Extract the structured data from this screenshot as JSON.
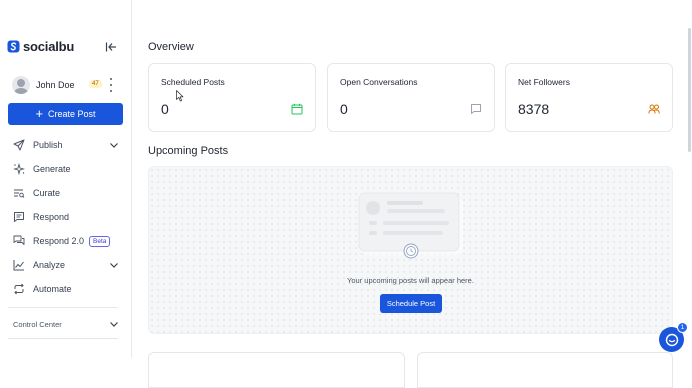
{
  "brand": {
    "name": "socialbu",
    "accent": "#1a56db"
  },
  "sidebar": {
    "collapse_icon": "collapse-left-icon",
    "user": {
      "name": "John Doe",
      "count": "47"
    },
    "create_post_label": "Create Post",
    "items": [
      {
        "label": "Publish",
        "icon": "send-icon",
        "expandable": true
      },
      {
        "label": "Generate",
        "icon": "sparkles-icon",
        "expandable": false
      },
      {
        "label": "Curate",
        "icon": "curate-icon",
        "expandable": false
      },
      {
        "label": "Respond",
        "icon": "message-icon",
        "expandable": false
      },
      {
        "label": "Respond 2.0",
        "icon": "messages-icon",
        "badge": "Beta",
        "expandable": false
      },
      {
        "label": "Analyze",
        "icon": "chart-line-icon",
        "expandable": true
      },
      {
        "label": "Automate",
        "icon": "repeat-icon",
        "expandable": false
      }
    ],
    "control_center_label": "Control Center"
  },
  "main": {
    "overview_title": "Overview",
    "cards": [
      {
        "title": "Scheduled Posts",
        "value": "0",
        "icon": "calendar-icon",
        "icon_color": "#22c55e"
      },
      {
        "title": "Open Conversations",
        "value": "0",
        "icon": "chat-bubble-icon",
        "icon_color": "#9ca3af"
      },
      {
        "title": "Net Followers",
        "value": "8378",
        "icon": "users-icon",
        "icon_color": "#d97706"
      }
    ],
    "upcoming_title": "Upcoming Posts",
    "empty_message": "Your upcoming posts will appear here.",
    "schedule_post_label": "Schedule Post"
  },
  "chat_widget": {
    "badge": "1"
  }
}
